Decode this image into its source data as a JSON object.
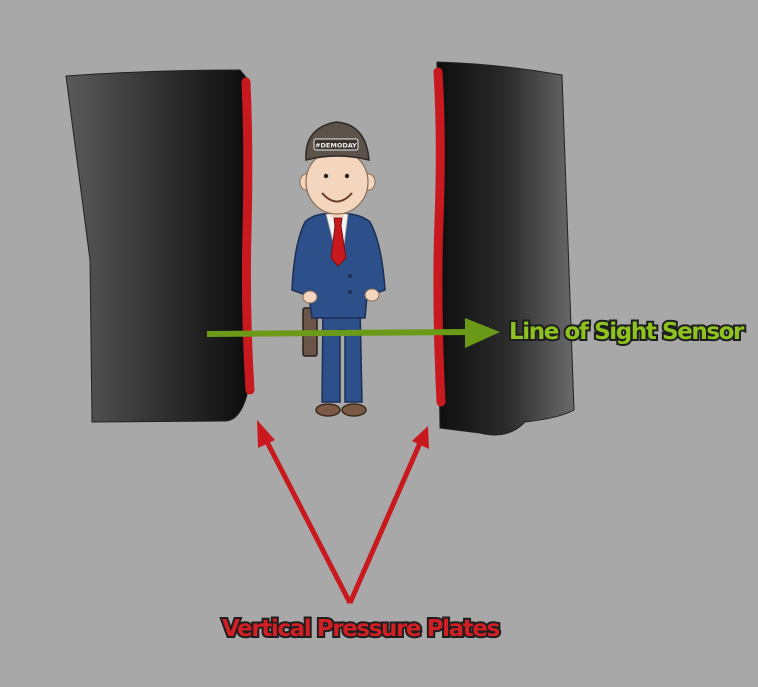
{
  "labels": {
    "sensor": "Line of Sight Sensor",
    "plates": "Vertical Pressure Plates"
  },
  "cap_text": "#DEMODAY",
  "colors": {
    "background": "#a8a8a8",
    "plate_red": "#c8191e",
    "sensor_green": "#6a9a18",
    "sensor_label": "#8ec21f",
    "plates_label": "#d11f24",
    "suit_blue": "#2d4f8a"
  }
}
